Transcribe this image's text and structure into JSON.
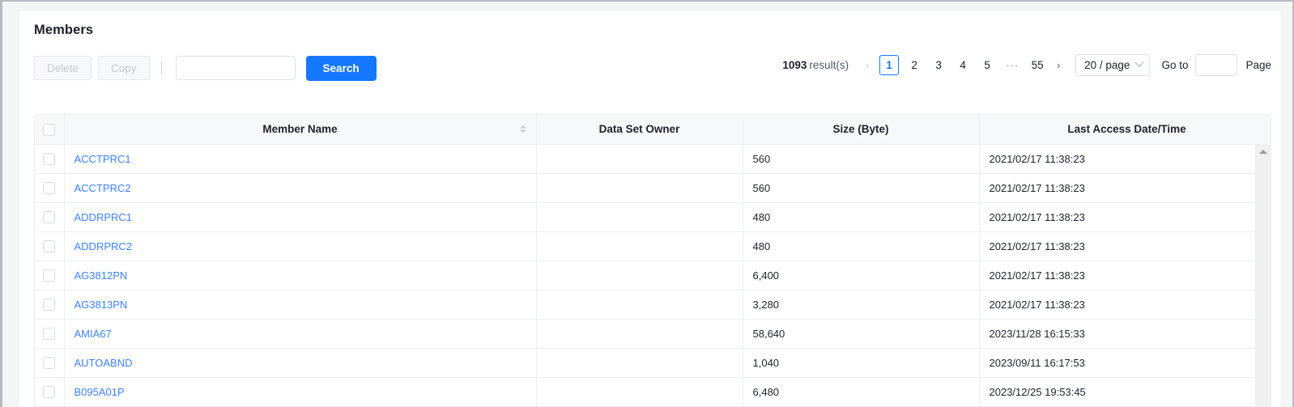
{
  "card": {
    "title": "Members"
  },
  "toolbar": {
    "delete_label": "Delete",
    "copy_label": "Copy",
    "search_value": "",
    "search_placeholder": "",
    "search_button_label": "Search"
  },
  "pagination": {
    "total_count": "1093",
    "total_suffix": "result(s)",
    "prev_icon": "chevron-left-icon",
    "next_icon": "chevron-right-icon",
    "prev_label": "‹",
    "next_label": "›",
    "pages": [
      "1",
      "2",
      "3",
      "4",
      "5"
    ],
    "ellipsis": "···",
    "last_page": "55",
    "active_page": "1",
    "page_size_label": "20 / page",
    "goto_label": "Go to",
    "goto_value": "",
    "page_label": "Page"
  },
  "table": {
    "columns": [
      {
        "key": "check",
        "label": "",
        "sortable": false
      },
      {
        "key": "name",
        "label": "Member Name",
        "sortable": true
      },
      {
        "key": "owner",
        "label": "Data Set Owner",
        "sortable": false
      },
      {
        "key": "size",
        "label": "Size (Byte)",
        "sortable": false
      },
      {
        "key": "date",
        "label": "Last Access Date/Time",
        "sortable": false
      },
      {
        "key": "extra",
        "label": "",
        "sortable": false
      }
    ],
    "rows": [
      {
        "name": "ACCTPRC1",
        "owner": "",
        "size": "560",
        "date": "2021/02/17 11:38:23"
      },
      {
        "name": "ACCTPRC2",
        "owner": "",
        "size": "560",
        "date": "2021/02/17 11:38:23"
      },
      {
        "name": "ADDRPRC1",
        "owner": "",
        "size": "480",
        "date": "2021/02/17 11:38:23"
      },
      {
        "name": "ADDRPRC2",
        "owner": "",
        "size": "480",
        "date": "2021/02/17 11:38:23"
      },
      {
        "name": "AG3812PN",
        "owner": "",
        "size": "6,400",
        "date": "2021/02/17 11:38:23"
      },
      {
        "name": "AG3813PN",
        "owner": "",
        "size": "3,280",
        "date": "2021/02/17 11:38:23"
      },
      {
        "name": "AMIA67",
        "owner": "",
        "size": "58,640",
        "date": "2023/11/28 16:15:33"
      },
      {
        "name": "AUTOABND",
        "owner": "",
        "size": "1,040",
        "date": "2023/09/11 16:17:53"
      },
      {
        "name": "B095A01P",
        "owner": "",
        "size": "6,480",
        "date": "2023/12/25 19:53:45"
      }
    ]
  },
  "colors": {
    "accent": "#1677ff",
    "link": "#4080ff",
    "header_bg": "#f7f8fa",
    "border": "#ebedf0",
    "text": "#1d2129"
  }
}
